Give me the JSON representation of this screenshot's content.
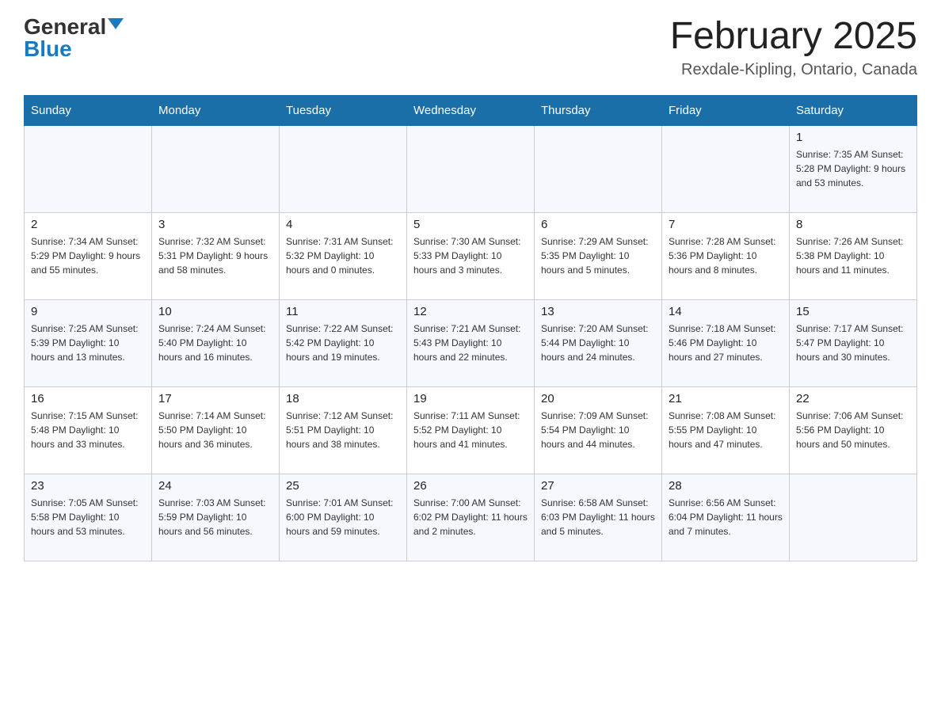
{
  "logo": {
    "general": "General",
    "blue": "Blue"
  },
  "title": {
    "month": "February 2025",
    "location": "Rexdale-Kipling, Ontario, Canada"
  },
  "headers": [
    "Sunday",
    "Monday",
    "Tuesday",
    "Wednesday",
    "Thursday",
    "Friday",
    "Saturday"
  ],
  "weeks": [
    [
      {
        "day": "",
        "info": ""
      },
      {
        "day": "",
        "info": ""
      },
      {
        "day": "",
        "info": ""
      },
      {
        "day": "",
        "info": ""
      },
      {
        "day": "",
        "info": ""
      },
      {
        "day": "",
        "info": ""
      },
      {
        "day": "1",
        "info": "Sunrise: 7:35 AM\nSunset: 5:28 PM\nDaylight: 9 hours and 53 minutes."
      }
    ],
    [
      {
        "day": "2",
        "info": "Sunrise: 7:34 AM\nSunset: 5:29 PM\nDaylight: 9 hours and 55 minutes."
      },
      {
        "day": "3",
        "info": "Sunrise: 7:32 AM\nSunset: 5:31 PM\nDaylight: 9 hours and 58 minutes."
      },
      {
        "day": "4",
        "info": "Sunrise: 7:31 AM\nSunset: 5:32 PM\nDaylight: 10 hours and 0 minutes."
      },
      {
        "day": "5",
        "info": "Sunrise: 7:30 AM\nSunset: 5:33 PM\nDaylight: 10 hours and 3 minutes."
      },
      {
        "day": "6",
        "info": "Sunrise: 7:29 AM\nSunset: 5:35 PM\nDaylight: 10 hours and 5 minutes."
      },
      {
        "day": "7",
        "info": "Sunrise: 7:28 AM\nSunset: 5:36 PM\nDaylight: 10 hours and 8 minutes."
      },
      {
        "day": "8",
        "info": "Sunrise: 7:26 AM\nSunset: 5:38 PM\nDaylight: 10 hours and 11 minutes."
      }
    ],
    [
      {
        "day": "9",
        "info": "Sunrise: 7:25 AM\nSunset: 5:39 PM\nDaylight: 10 hours and 13 minutes."
      },
      {
        "day": "10",
        "info": "Sunrise: 7:24 AM\nSunset: 5:40 PM\nDaylight: 10 hours and 16 minutes."
      },
      {
        "day": "11",
        "info": "Sunrise: 7:22 AM\nSunset: 5:42 PM\nDaylight: 10 hours and 19 minutes."
      },
      {
        "day": "12",
        "info": "Sunrise: 7:21 AM\nSunset: 5:43 PM\nDaylight: 10 hours and 22 minutes."
      },
      {
        "day": "13",
        "info": "Sunrise: 7:20 AM\nSunset: 5:44 PM\nDaylight: 10 hours and 24 minutes."
      },
      {
        "day": "14",
        "info": "Sunrise: 7:18 AM\nSunset: 5:46 PM\nDaylight: 10 hours and 27 minutes."
      },
      {
        "day": "15",
        "info": "Sunrise: 7:17 AM\nSunset: 5:47 PM\nDaylight: 10 hours and 30 minutes."
      }
    ],
    [
      {
        "day": "16",
        "info": "Sunrise: 7:15 AM\nSunset: 5:48 PM\nDaylight: 10 hours and 33 minutes."
      },
      {
        "day": "17",
        "info": "Sunrise: 7:14 AM\nSunset: 5:50 PM\nDaylight: 10 hours and 36 minutes."
      },
      {
        "day": "18",
        "info": "Sunrise: 7:12 AM\nSunset: 5:51 PM\nDaylight: 10 hours and 38 minutes."
      },
      {
        "day": "19",
        "info": "Sunrise: 7:11 AM\nSunset: 5:52 PM\nDaylight: 10 hours and 41 minutes."
      },
      {
        "day": "20",
        "info": "Sunrise: 7:09 AM\nSunset: 5:54 PM\nDaylight: 10 hours and 44 minutes."
      },
      {
        "day": "21",
        "info": "Sunrise: 7:08 AM\nSunset: 5:55 PM\nDaylight: 10 hours and 47 minutes."
      },
      {
        "day": "22",
        "info": "Sunrise: 7:06 AM\nSunset: 5:56 PM\nDaylight: 10 hours and 50 minutes."
      }
    ],
    [
      {
        "day": "23",
        "info": "Sunrise: 7:05 AM\nSunset: 5:58 PM\nDaylight: 10 hours and 53 minutes."
      },
      {
        "day": "24",
        "info": "Sunrise: 7:03 AM\nSunset: 5:59 PM\nDaylight: 10 hours and 56 minutes."
      },
      {
        "day": "25",
        "info": "Sunrise: 7:01 AM\nSunset: 6:00 PM\nDaylight: 10 hours and 59 minutes."
      },
      {
        "day": "26",
        "info": "Sunrise: 7:00 AM\nSunset: 6:02 PM\nDaylight: 11 hours and 2 minutes."
      },
      {
        "day": "27",
        "info": "Sunrise: 6:58 AM\nSunset: 6:03 PM\nDaylight: 11 hours and 5 minutes."
      },
      {
        "day": "28",
        "info": "Sunrise: 6:56 AM\nSunset: 6:04 PM\nDaylight: 11 hours and 7 minutes."
      },
      {
        "day": "",
        "info": ""
      }
    ]
  ]
}
